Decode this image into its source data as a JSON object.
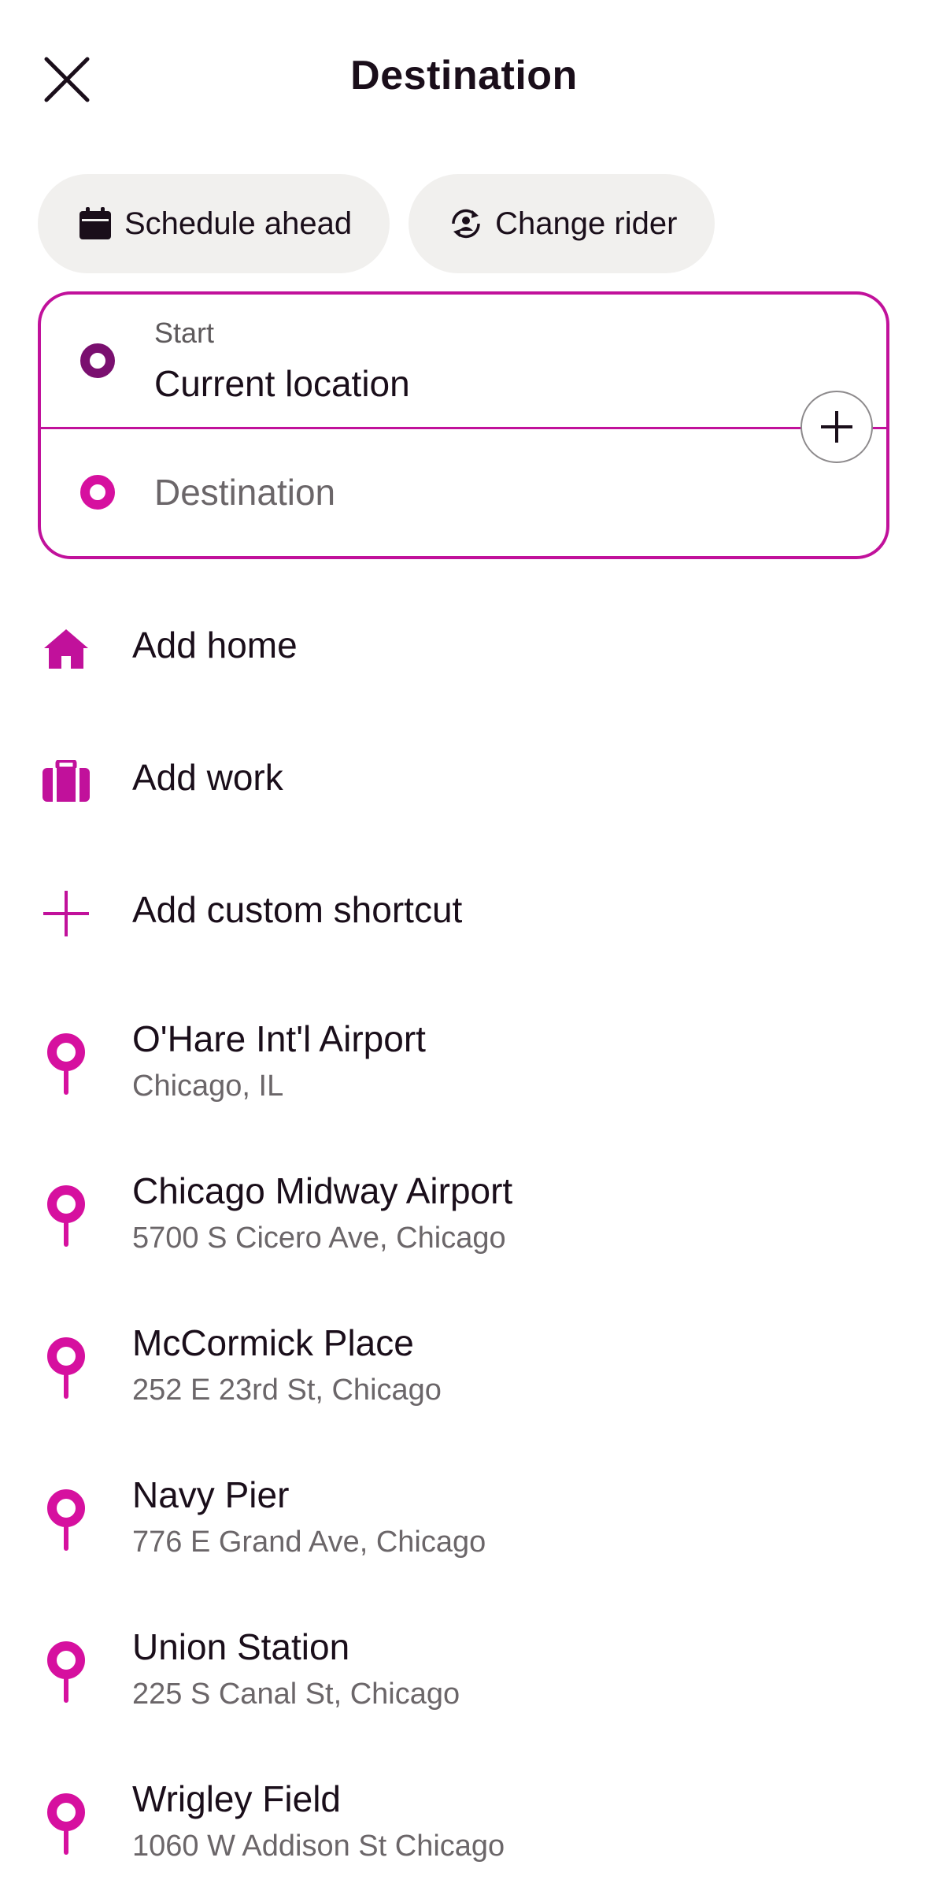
{
  "header": {
    "title": "Destination",
    "close_icon": "close-icon"
  },
  "chips": [
    {
      "label": "Schedule ahead",
      "icon": "calendar-icon"
    },
    {
      "label": "Change rider",
      "icon": "rider-switch-icon"
    }
  ],
  "route": {
    "start_label": "Start",
    "start_value": "Current location",
    "destination_placeholder": "Destination",
    "add_stop_icon": "plus-icon"
  },
  "shortcuts": [
    {
      "label": "Add home",
      "icon": "home-icon"
    },
    {
      "label": "Add work",
      "icon": "briefcase-icon"
    },
    {
      "label": "Add custom shortcut",
      "icon": "plus-icon"
    }
  ],
  "places": [
    {
      "name": "O'Hare Int'l Airport",
      "address": "Chicago, IL"
    },
    {
      "name": "Chicago Midway Airport",
      "address": "5700 S Cicero Ave, Chicago"
    },
    {
      "name": "McCormick Place",
      "address": "252 E 23rd St, Chicago"
    },
    {
      "name": "Navy Pier",
      "address": "776 E Grand Ave, Chicago"
    },
    {
      "name": "Union Station",
      "address": "225 S Canal St, Chicago"
    },
    {
      "name": "Wrigley Field",
      "address": "1060 W Addison St Chicago"
    }
  ],
  "colors": {
    "accent": "#c1119b",
    "accent_dark": "#7a0f6f",
    "chip_bg": "#f1f0ee",
    "text": "#1a0e1a",
    "muted_text": "#6b6669"
  }
}
